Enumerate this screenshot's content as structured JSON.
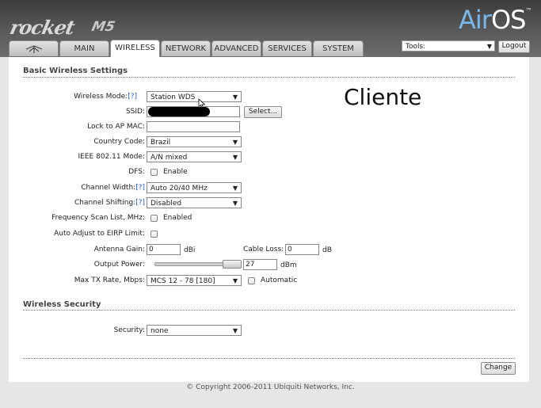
{
  "header": {
    "product_logo": "rocket",
    "model_logo": "M5",
    "airos_logo": {
      "air": "Air",
      "os": "OS",
      "tm": "™"
    },
    "tools": {
      "label": "Tools:"
    },
    "logout_label": "Logout"
  },
  "tabs": [
    {
      "label": "",
      "icon": "ubiquiti-logo-icon"
    },
    {
      "label": "MAIN"
    },
    {
      "label": "WIRELESS",
      "active": true
    },
    {
      "label": "NETWORK"
    },
    {
      "label": "ADVANCED"
    },
    {
      "label": "SERVICES"
    },
    {
      "label": "SYSTEM"
    }
  ],
  "basic": {
    "title": "Basic Wireless Settings",
    "help": "[?]",
    "wireless_mode": {
      "label": "Wireless Mode:",
      "value": "Station WDS"
    },
    "ssid": {
      "label": "SSID:",
      "value": "",
      "select_label": "Select..."
    },
    "lock_ap_mac": {
      "label": "Lock to AP MAC:",
      "value": ""
    },
    "country_code": {
      "label": "Country Code:",
      "value": "Brazil"
    },
    "ieee_mode": {
      "label": "IEEE 802.11 Mode:",
      "value": "A/N mixed"
    },
    "dfs": {
      "label": "DFS:",
      "checkbox_label": "Enable",
      "checked": false
    },
    "channel_width": {
      "label": "Channel Width:",
      "value": "Auto 20/40 MHz"
    },
    "channel_shifting": {
      "label": "Channel Shifting:",
      "value": "Disabled"
    },
    "freq_scan": {
      "label": "Frequency Scan List, MHz:",
      "checkbox_label": "Enabled",
      "checked": false
    },
    "auto_eirp": {
      "label": "Auto Adjust to EIRP Limit:",
      "checked": false
    },
    "antenna_gain": {
      "label": "Antenna Gain:",
      "value": "0",
      "unit": "dBi"
    },
    "cable_loss": {
      "label": "Cable Loss:",
      "value": "0",
      "unit": "dB"
    },
    "output_power": {
      "label": "Output Power:",
      "value": "27",
      "unit": "dBm",
      "slider_fraction": 1.0
    },
    "max_tx_rate": {
      "label": "Max TX Rate, Mbps:",
      "value": "MCS 12 - 78 [180]",
      "checkbox_label": "Automatic",
      "checked": false
    }
  },
  "annotation": "Cliente",
  "security": {
    "title": "Wireless Security",
    "security": {
      "label": "Security:",
      "value": "none"
    }
  },
  "change_label": "Change",
  "footer": "© Copyright 2006-2011 Ubiquiti Networks, Inc.",
  "colors": {
    "airos_blue": "#7ab7ea",
    "help_link": "#1f61c6"
  }
}
